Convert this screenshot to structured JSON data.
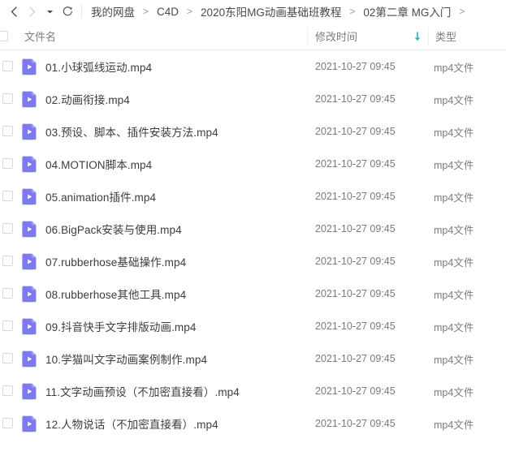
{
  "nav": {
    "back_icon": "chevron-left-icon",
    "forward_icon": "chevron-right-icon",
    "dropdown_icon": "caret-down-icon",
    "refresh_icon": "refresh-icon",
    "separator_arrow": ">",
    "breadcrumbs": [
      "我的网盘",
      "C4D",
      "2020东阳MG动画基础班教程",
      "02第二章 MG入门"
    ],
    "trailing_arrow": ">"
  },
  "columns": {
    "name": "文件名",
    "modified": "修改时间",
    "type": "类型",
    "sort_icon": "sort-descending-arrow-icon",
    "sort_color": "#2bb3c0"
  },
  "theme": {
    "icon_purple": "#7d7af0",
    "icon_purple_light": "#a5a3f5",
    "text_primary": "#3d3d3d",
    "text_secondary": "#7b7b7b",
    "border": "#eeeeee"
  },
  "files": [
    {
      "name": "01.小球弧线运动.mp4",
      "modified": "2021-10-27 09:45",
      "type": "mp4文件",
      "icon": "mp4-video-file-icon"
    },
    {
      "name": "02.动画衔接.mp4",
      "modified": "2021-10-27 09:45",
      "type": "mp4文件",
      "icon": "mp4-video-file-icon"
    },
    {
      "name": "03.预设、脚本、插件安装方法.mp4",
      "modified": "2021-10-27 09:45",
      "type": "mp4文件",
      "icon": "mp4-video-file-icon"
    },
    {
      "name": "04.MOTION脚本.mp4",
      "modified": "2021-10-27 09:45",
      "type": "mp4文件",
      "icon": "mp4-video-file-icon"
    },
    {
      "name": "05.animation插件.mp4",
      "modified": "2021-10-27 09:45",
      "type": "mp4文件",
      "icon": "mp4-video-file-icon"
    },
    {
      "name": "06.BigPack安装与使用.mp4",
      "modified": "2021-10-27 09:45",
      "type": "mp4文件",
      "icon": "mp4-video-file-icon"
    },
    {
      "name": "07.rubberhose基础操作.mp4",
      "modified": "2021-10-27 09:45",
      "type": "mp4文件",
      "icon": "mp4-video-file-icon"
    },
    {
      "name": "08.rubberhose其他工具.mp4",
      "modified": "2021-10-27 09:45",
      "type": "mp4文件",
      "icon": "mp4-video-file-icon"
    },
    {
      "name": "09.抖音快手文字排版动画.mp4",
      "modified": "2021-10-27 09:45",
      "type": "mp4文件",
      "icon": "mp4-video-file-icon"
    },
    {
      "name": "10.学猫叫文字动画案例制作.mp4",
      "modified": "2021-10-27 09:45",
      "type": "mp4文件",
      "icon": "mp4-video-file-icon"
    },
    {
      "name": "11.文字动画预设（不加密直接看）.mp4",
      "modified": "2021-10-27 09:45",
      "type": "mp4文件",
      "icon": "mp4-video-file-icon"
    },
    {
      "name": "12.人物说话（不加密直接看）.mp4",
      "modified": "2021-10-27 09:45",
      "type": "mp4文件",
      "icon": "mp4-video-file-icon"
    }
  ]
}
